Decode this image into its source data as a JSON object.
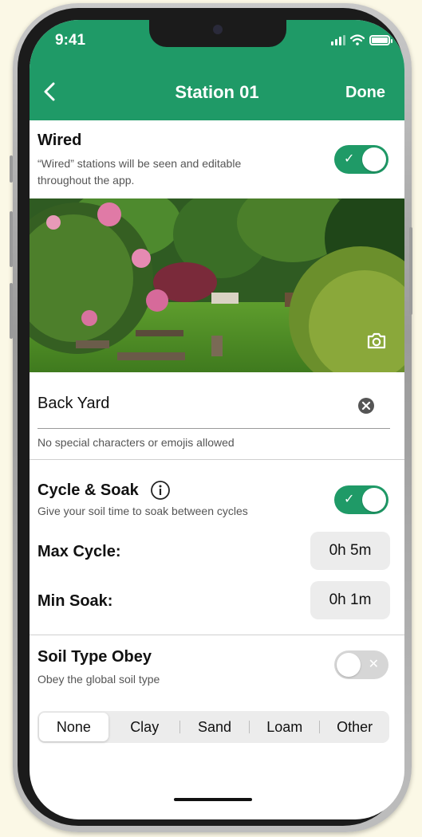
{
  "status_bar": {
    "time": "9:41"
  },
  "nav": {
    "title": "Station 01",
    "done_label": "Done"
  },
  "wired": {
    "title": "Wired",
    "description": "“Wired” stations will be seen and editable throughout the app.",
    "enabled": true
  },
  "station_name": {
    "value": "Back Yard",
    "helper": "No special characters or emojis allowed"
  },
  "cycle_soak": {
    "title": "Cycle & Soak",
    "description": "Give your soil time to soak between cycles",
    "enabled": true,
    "max_cycle_label": "Max Cycle:",
    "max_cycle_value": "0h 5m",
    "min_soak_label": "Min Soak:",
    "min_soak_value": "0h 1m"
  },
  "soil_type": {
    "title": "Soil Type Obey",
    "description": "Obey the global soil type",
    "enabled": false,
    "options": [
      "None",
      "Clay",
      "Sand",
      "Loam",
      "Other"
    ],
    "selected": "None"
  },
  "icons": {
    "back": "chevron-left-icon",
    "info": "info-icon",
    "camera": "camera-icon",
    "clear": "clear-icon",
    "toggle_on": "check-icon",
    "toggle_off": "x-icon"
  },
  "colors": {
    "brand_green": "#1f9a67",
    "background": "#fbf8e6"
  }
}
